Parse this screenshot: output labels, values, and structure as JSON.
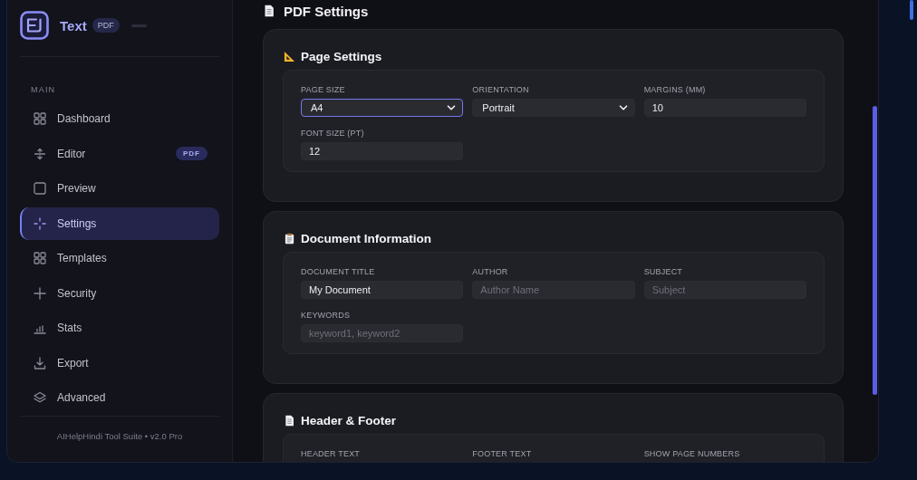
{
  "page_title": "PDF Settings",
  "sidebar": {
    "brand": {
      "name": "Text",
      "badge": "PDF"
    },
    "section_label": "MAIN",
    "items": [
      {
        "label": "Dashboard",
        "selected": false
      },
      {
        "label": "Editor",
        "selected": false,
        "badge": "PDF"
      },
      {
        "label": "Preview",
        "selected": false
      },
      {
        "label": "Settings",
        "selected": true
      },
      {
        "label": "Templates",
        "selected": false
      },
      {
        "label": "Security",
        "selected": false
      },
      {
        "label": "Stats",
        "selected": false
      },
      {
        "label": "Export",
        "selected": false
      },
      {
        "label": "Advanced",
        "selected": false
      }
    ],
    "footer": "AIHelpHindi Tool Suite • v2.0 Pro"
  },
  "panels": [
    {
      "title": "Page Settings",
      "fields": [
        {
          "label": "PAGE SIZE",
          "kind": "select",
          "value": "A4",
          "focused": true
        },
        {
          "label": "ORIENTATION",
          "kind": "select",
          "value": "Portrait",
          "focused": false
        },
        {
          "label": "MARGINS (MM)",
          "kind": "input",
          "value": "10",
          "focused": false
        },
        {
          "label": "FONT SIZE (PT)",
          "kind": "input",
          "value": "12",
          "focused": false
        }
      ]
    },
    {
      "title": "Document Information",
      "fields": [
        {
          "label": "DOCUMENT TITLE",
          "kind": "input",
          "value": "My Document",
          "focused": false
        },
        {
          "label": "AUTHOR",
          "kind": "input",
          "placeholder": "Author Name",
          "focused": false
        },
        {
          "label": "SUBJECT",
          "kind": "input",
          "placeholder": "Subject",
          "focused": false
        },
        {
          "label": "KEYWORDS",
          "kind": "input",
          "placeholder": "keyword1, keyword2",
          "focused": false
        }
      ]
    },
    {
      "title": "Header & Footer",
      "fields": [
        {
          "label": "HEADER TEXT"
        },
        {
          "label": "FOOTER TEXT"
        },
        {
          "label": "SHOW PAGE NUMBERS"
        }
      ]
    }
  ]
}
